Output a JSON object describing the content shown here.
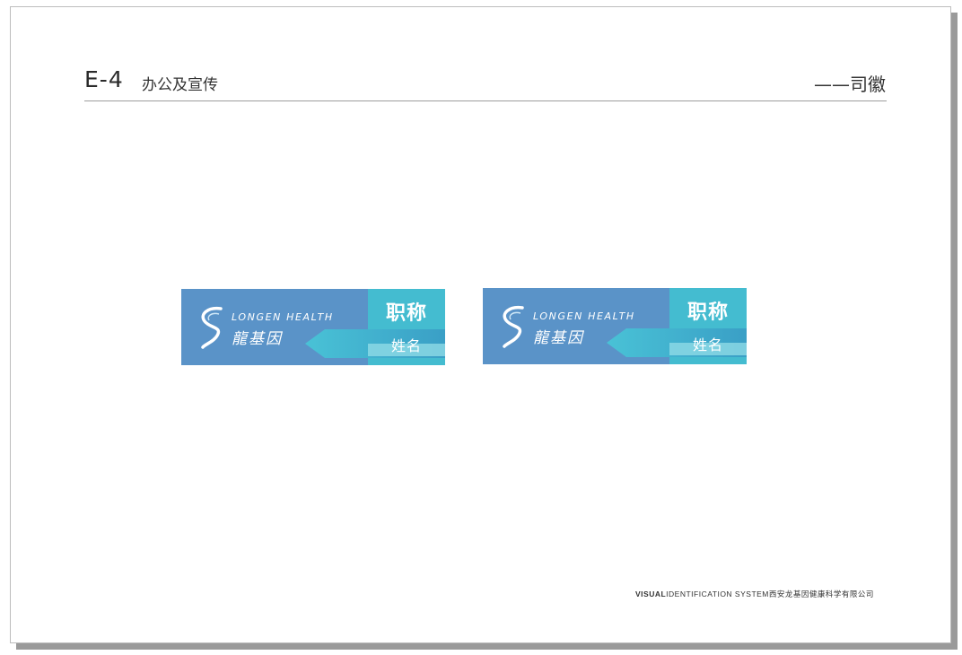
{
  "header": {
    "code": "E-4",
    "section": "办公及宣传",
    "subsection": "——司徽"
  },
  "signs": [
    {
      "title": "职称",
      "name": "姓名",
      "brand_en": "LONGEN HEALTH",
      "brand_cn": "龍基因"
    },
    {
      "title": "职称",
      "name": "姓名",
      "brand_en": "LONGEN HEALTH",
      "brand_cn": "龍基因"
    }
  ],
  "footer": {
    "bold": "VISUAL",
    "rest": "IDENTIFICATION SYSTEM西安龙基因健康科学有限公司"
  },
  "colors": {
    "sign_blue": "#5a93c8",
    "panel_teal": "#44bcd0",
    "arrow_light": "#8fdbe6"
  },
  "icons": {
    "logo": "longen-s-logo-icon",
    "arrow": "arrow-ribbon-icon"
  }
}
